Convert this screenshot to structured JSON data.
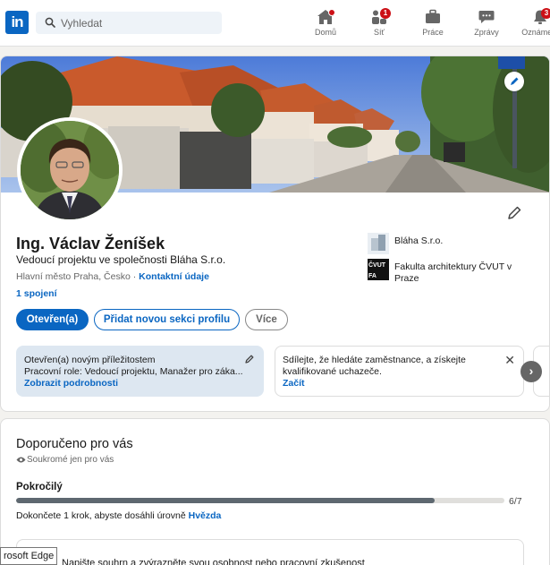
{
  "nav": {
    "logo_text": "in",
    "search_placeholder": "Vyhledat",
    "items": [
      {
        "label": "Domů",
        "icon": "home-icon"
      },
      {
        "label": "Síť",
        "icon": "network-icon",
        "badge": "1"
      },
      {
        "label": "Práce",
        "icon": "briefcase-icon"
      },
      {
        "label": "Zprávy",
        "icon": "messaging-icon"
      },
      {
        "label": "Oznámení",
        "icon": "bell-icon",
        "badge": "3"
      }
    ]
  },
  "profile": {
    "name": "Ing. Václav Ženíšek",
    "headline": "Vedoucí projektu ve společnosti Bláha S.r.o.",
    "location": "Hlavní město Praha, Česko",
    "location_sep": " · ",
    "contact_link": "Kontaktní údaje",
    "connections": "1 spojení",
    "orgs": [
      {
        "name": "Bláha S.r.o."
      },
      {
        "name": "Fakulta architektury ČVUT v Praze",
        "logo_text_top": "ČVUT",
        "logo_text_bottom": "FA"
      }
    ],
    "buttons": {
      "open_to": "Otevřen(a)",
      "add_section": "Přidat novou sekci profilu",
      "more": "Více"
    },
    "open_to_work": {
      "title": "Otevřen(a) novým příležitostem",
      "roles": "Pracovní role: Vedoucí projektu, Manažer pro záka...",
      "link": "Zobrazit podrobnosti"
    },
    "hiring": {
      "text": "Sdílejte, že hledáte zaměstnance, a získejte kvalifikované uchazeče.",
      "link": "Začít"
    },
    "next_arrow": "›",
    "close_symbol": "✕"
  },
  "recommended": {
    "title": "Doporučeno pro vás",
    "private_note": "Soukromé jen pro vás",
    "level": "Pokročilý",
    "progress_done": 6,
    "progress_total": 7,
    "progress_label": "6/7",
    "complete_text": "Dokončete 1 krok, abyste dosáhli úrovně ",
    "complete_link": "Hvězda",
    "inner_text": "Napište souhrn a zvýrazněte svou osobnost nebo pracovní zkušenost"
  },
  "tooltip": "rosoft Edge",
  "colors": {
    "accent": "#0a66c2",
    "badge": "#cc1016",
    "open_to_work_bg": "#dde7f1",
    "background": "#f3f2ef"
  }
}
